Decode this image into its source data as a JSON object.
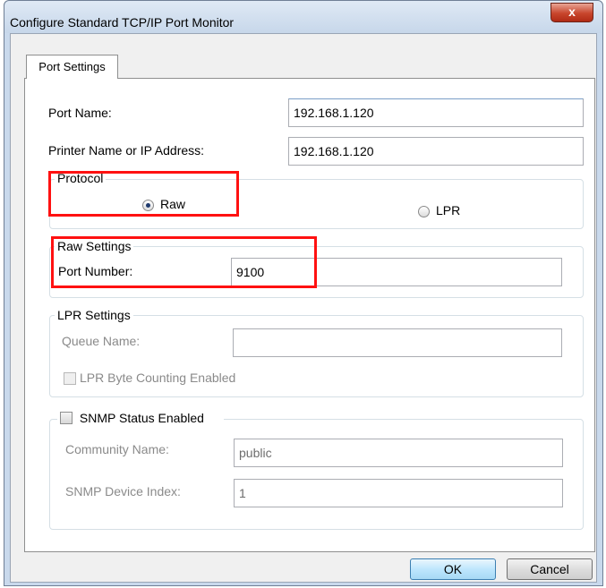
{
  "window": {
    "title": "Configure Standard TCP/IP Port Monitor",
    "close_label": "x"
  },
  "tab": {
    "label": "Port Settings"
  },
  "port_name": {
    "label": "Port Name:",
    "value": "192.168.1.120"
  },
  "printer_name": {
    "label": "Printer Name or IP Address:",
    "value": "192.168.1.120"
  },
  "protocol": {
    "title": "Protocol",
    "options": [
      {
        "label": "Raw",
        "selected": true
      },
      {
        "label": "LPR",
        "selected": false
      }
    ]
  },
  "raw_settings": {
    "title": "Raw Settings",
    "port_number_label": "Port Number:",
    "port_number_value": "9100"
  },
  "lpr_settings": {
    "title": "LPR Settings",
    "queue_name_label": "Queue Name:",
    "queue_name_value": "",
    "byte_counting_label": "LPR Byte Counting Enabled",
    "byte_counting_checked": false
  },
  "snmp": {
    "enabled_label": "SNMP Status Enabled",
    "enabled_checked": false,
    "community_label": "Community Name:",
    "community_value": "public",
    "device_index_label": "SNMP Device Index:",
    "device_index_value": "1"
  },
  "buttons": {
    "ok": "OK",
    "cancel": "Cancel"
  },
  "colors": {
    "highlight": "#ff1111",
    "close_button": "#c8452c",
    "title_bar": "#c7d7ea"
  }
}
